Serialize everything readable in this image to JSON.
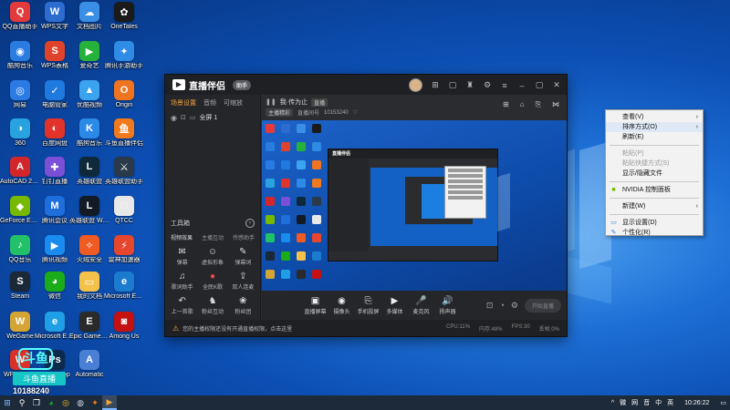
{
  "desktop": {
    "icons": [
      {
        "label": "QQ直播助手",
        "glyph": "Q",
        "color": "#e23b3b"
      },
      {
        "label": "WPS文字",
        "glyph": "W",
        "color": "#2d6ccf"
      },
      {
        "label": "文档图片",
        "glyph": "☁",
        "color": "#3a8ee6"
      },
      {
        "label": "OneTales",
        "glyph": "✿",
        "color": "#1a1a1a"
      },
      {
        "label": "酷狗音乐",
        "glyph": "◉",
        "color": "#2b7ce0"
      },
      {
        "label": "WPS表格",
        "glyph": "S",
        "color": "#e0432c"
      },
      {
        "label": "爱奇艺",
        "glyph": "▶",
        "color": "#25b23b"
      },
      {
        "label": "腾讯手游助手",
        "glyph": "✦",
        "color": "#2e8be6"
      },
      {
        "label": "网易",
        "glyph": "◎",
        "color": "#2c7be5"
      },
      {
        "label": "电脑管家",
        "glyph": "✓",
        "color": "#1f7ae0"
      },
      {
        "label": "优酷视频",
        "glyph": "▲",
        "color": "#3aa4f1"
      },
      {
        "label": "Origin",
        "glyph": "O",
        "color": "#f0741f"
      },
      {
        "label": "360",
        "glyph": "◑",
        "color": "#29a3e0"
      },
      {
        "label": "百度网盘",
        "glyph": "◐",
        "color": "#e2332a"
      },
      {
        "label": "酷狗音乐",
        "glyph": "K",
        "color": "#2b8ae8"
      },
      {
        "label": "斗鱼直播伴侣",
        "glyph": "鱼",
        "color": "#f07a1d"
      },
      {
        "label": "AutoCAD 2020",
        "glyph": "A",
        "color": "#d3262b"
      },
      {
        "label": "钉钉直播",
        "glyph": "✚",
        "color": "#7b4fd6"
      },
      {
        "label": "英雄联盟",
        "glyph": "L",
        "color": "#0e2a3a"
      },
      {
        "label": "英雄联盟助手",
        "glyph": "⚔",
        "color": "#2a3a4a"
      },
      {
        "label": "GeForce Experience",
        "glyph": "◆",
        "color": "#76b900"
      },
      {
        "label": "腾讯会议",
        "glyph": "M",
        "color": "#1e6fdb"
      },
      {
        "label": "英雄联盟 WeGame版",
        "glyph": "L",
        "color": "#121a26"
      },
      {
        "label": "QTCC",
        "glyph": "□",
        "color": "#e8e8e8"
      },
      {
        "label": "QQ音乐",
        "glyph": "♪",
        "color": "#23c06a"
      },
      {
        "label": "腾讯视频",
        "glyph": "▶",
        "color": "#1a8cf0"
      },
      {
        "label": "火绒安全",
        "glyph": "✧",
        "color": "#f05a23"
      },
      {
        "label": "雷神加速器",
        "glyph": "⚡",
        "color": "#e6462c"
      },
      {
        "label": "Steam",
        "glyph": "S",
        "color": "#1b2838"
      },
      {
        "label": "微信",
        "glyph": "◕",
        "color": "#1aad19"
      },
      {
        "label": "我的文档",
        "glyph": "▭",
        "color": "#f4c24a"
      },
      {
        "label": "Microsoft Edge",
        "glyph": "e",
        "color": "#1b7ccf"
      },
      {
        "label": "WeGame",
        "glyph": "W",
        "color": "#d4a435"
      },
      {
        "label": "Microsoft Edge",
        "glyph": "e",
        "color": "#1fa0e6"
      },
      {
        "label": "Epic Games Launcher",
        "glyph": "E",
        "color": "#2a2a2a"
      },
      {
        "label": "Among Us",
        "glyph": "◙",
        "color": "#c51111"
      },
      {
        "label": "WPS Office",
        "glyph": "W",
        "color": "#d9312a"
      },
      {
        "label": "Photoshop",
        "glyph": "Ps",
        "color": "#0c2a4a"
      },
      {
        "label": "Automatic",
        "glyph": "A",
        "color": "#4a7fd6"
      }
    ],
    "watermark": {
      "mark": "斗鱼",
      "brand": "斗鱼直播",
      "number": "10188240"
    }
  },
  "app": {
    "title": "直播伴侣",
    "badge": "助手",
    "left_tabs": [
      "场景设置",
      "音频",
      "可缩放"
    ],
    "scene_name": "全屏 1",
    "toolbox_title": "工具箱",
    "toolbox_tabs": [
      "视频效果",
      "主播互动",
      "传感助手"
    ],
    "tools": [
      {
        "label": "弹幕",
        "icon": "✉"
      },
      {
        "label": "虚拟形象",
        "icon": "☺"
      },
      {
        "label": "弹幕词",
        "icon": "✎"
      },
      {
        "label": "歌词助手",
        "icon": "♫"
      },
      {
        "label": "全民K歌",
        "icon": "●",
        "red": true
      },
      {
        "label": "双人连麦",
        "icon": "⇪"
      },
      {
        "label": "上一首歌",
        "icon": "↶"
      },
      {
        "label": "粉丝互动",
        "icon": "♞"
      },
      {
        "label": "粉丝团",
        "icon": "❀"
      }
    ],
    "preview_title": "我·传为止",
    "preview_tag": "直播",
    "preview_meta": {
      "tag": "主播精彩",
      "room": "直播间号",
      "id": "10153240"
    },
    "controls": [
      {
        "label": "直播屏幕",
        "icon": "▣"
      },
      {
        "label": "摄像头",
        "icon": "◉"
      },
      {
        "label": "手机投屏",
        "icon": "⎘"
      },
      {
        "label": "多媒体",
        "icon": "▶"
      },
      {
        "label": "麦克风",
        "icon": "🎤"
      },
      {
        "label": "扬声器",
        "icon": "🔊"
      }
    ],
    "start_label": "开始直播",
    "status_text": "您的主播权限还没有开通直播权限，点击这里",
    "status_stats": [
      "CPU:11%",
      "内存:48%",
      "FPS:30",
      "丢帧:0%"
    ]
  },
  "context_menu": {
    "items": [
      {
        "label": "查看(V)",
        "arrow": true
      },
      {
        "label": "排序方式(O)",
        "arrow": true,
        "highlight": true
      },
      {
        "label": "刷新(E)"
      },
      {
        "sep": true
      },
      {
        "label": "粘贴(P)",
        "disabled": true
      },
      {
        "label": "粘贴快捷方式(S)",
        "disabled": true
      },
      {
        "label": "显示/隐藏文件"
      },
      {
        "sep": true
      },
      {
        "label": "NVIDIA 控制面板",
        "icon": "■",
        "icon_color": "#76b900"
      },
      {
        "sep": true
      },
      {
        "label": "新建(W)",
        "arrow": true
      },
      {
        "sep": true
      },
      {
        "label": "显示设置(D)",
        "icon": "▭",
        "icon_color": "#2b7ce0"
      },
      {
        "label": "个性化(R)",
        "icon": "✎",
        "icon_color": "#2b7ce0"
      }
    ]
  },
  "taskbar": {
    "items": [
      "start",
      "search",
      "taskview",
      "wechat",
      "chrome",
      "steam",
      "douyu",
      "live"
    ],
    "tray": [
      "^",
      "微",
      "网",
      "音",
      "中",
      "英"
    ],
    "clock": "10:26:22",
    "colors": {
      "bg": "#1d2a3a",
      "accent": "#7fb8ff"
    }
  }
}
